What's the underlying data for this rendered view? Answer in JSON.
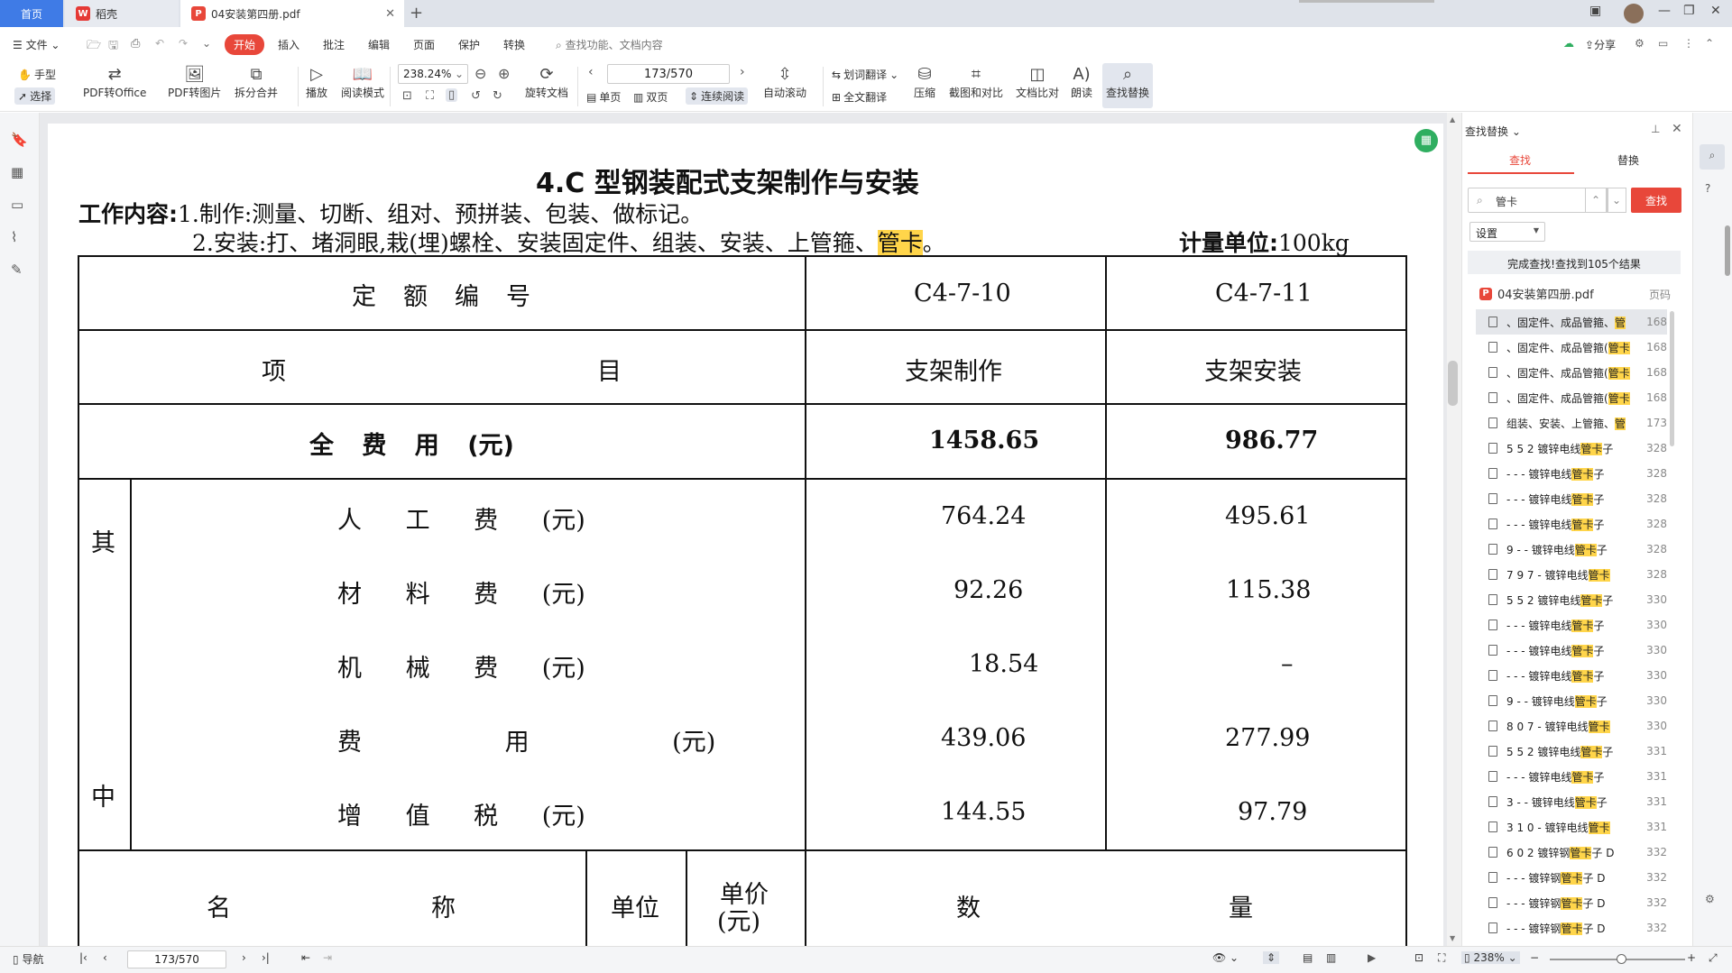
{
  "tabs": {
    "home": "首页",
    "daoke": "稻壳",
    "pdf": "04安装第四册.pdf"
  },
  "menu": {
    "file": "文件",
    "start": "开始",
    "insert": "插入",
    "annotate": "批注",
    "edit": "编辑",
    "page": "页面",
    "protect": "保护",
    "convert": "转换",
    "search_placeholder": "查找功能、文档内容",
    "share": "分享"
  },
  "ribbon": {
    "hand": "手型",
    "select": "选择",
    "pdf_to_office": "PDF转Office",
    "pdf_to_image": "PDF转图片",
    "split_merge": "拆分合并",
    "play": "播放",
    "read_mode": "阅读模式",
    "zoom": "238.24%",
    "page_input": "173/570",
    "rotate_doc": "旋转文档",
    "single_page": "单页",
    "double_page": "双页",
    "continuous": "连续阅读",
    "auto_scroll": "自动滚动",
    "word_translate": "划词翻译",
    "full_translate": "全文翻译",
    "compress": "压缩",
    "screenshot_compare": "截图和对比",
    "doc_compare": "文档比对",
    "read_aloud": "朗读",
    "find_replace": "查找替换"
  },
  "document": {
    "title": "4.C 型钢装配式支架制作与安装",
    "work_label": "工作内容:",
    "work_line1": "1.制作:测量、切断、组对、预拼装、包装、做标记。",
    "work_line2_pre": "2.安装:打、堵洞眼,栽(埋)螺栓、安装固定件、组装、安装、上管箍、",
    "work_line2_hl": "管卡",
    "work_line2_post": "。",
    "unit_label": "计量单位:",
    "unit_value": "100kg",
    "table": {
      "quota_no_label": "定额编号",
      "code1": "C4-7-10",
      "code2": "C4-7-11",
      "item_label_1": "项",
      "item_label_2": "目",
      "col1_name": "支架制作",
      "col2_name": "支架安装",
      "total_label": "全 费 用 (元)",
      "total1": "1458.65",
      "total2": "986.77",
      "qi": "其",
      "zhong": "中",
      "rows": [
        {
          "label": "人 工 费 (元)",
          "v1": "764.24",
          "v2": "495.61"
        },
        {
          "label": "材 料 费 (元)",
          "v1": "92.26",
          "v2": "115.38"
        },
        {
          "label": "机 械 费 (元)",
          "v1": "18.54",
          "v2": "–"
        },
        {
          "label": "费 用 (元)",
          "v1": "439.06",
          "v2": "277.99"
        },
        {
          "label": "增 值 税 (元)",
          "v1": "144.55",
          "v2": "97.79"
        }
      ],
      "name_label_1": "名",
      "name_label_2": "称",
      "unit_col": "单位",
      "price_col_1": "单价",
      "price_col_2": "(元)",
      "qty_label_1": "数",
      "qty_label_2": "量"
    }
  },
  "panel": {
    "title": "查找替换",
    "tab_find": "查找",
    "tab_replace": "替换",
    "search_value": "管卡",
    "find_button": "查找",
    "settings": "设置",
    "status": "完成查找!查找到105个结果",
    "file_name": "04安装第四册.pdf",
    "page_col": "页码",
    "results": [
      {
        "pre": "、固定件、成品管箍、",
        "hl": "管",
        "post": "",
        "page": "168"
      },
      {
        "pre": "、固定件、成品管箍(",
        "hl": "管卡",
        "post": "",
        "page": "168"
      },
      {
        "pre": "、固定件、成品管箍(",
        "hl": "管卡",
        "post": "",
        "page": "168"
      },
      {
        "pre": "、固定件、成品管箍(",
        "hl": "管卡",
        "post": "",
        "page": "168"
      },
      {
        "pre": "组装、安装、上管箍、",
        "hl": "管",
        "post": "",
        "page": "173"
      },
      {
        "pre": "5 5 2 镀锌电线",
        "hl": "管卡",
        "post": "子",
        "page": "328"
      },
      {
        "pre": "- - - 镀锌电线",
        "hl": "管卡",
        "post": "子",
        "page": "328"
      },
      {
        "pre": "- - - 镀锌电线",
        "hl": "管卡",
        "post": "子",
        "page": "328"
      },
      {
        "pre": "- - - 镀锌电线",
        "hl": "管卡",
        "post": "子",
        "page": "328"
      },
      {
        "pre": "9 - - 镀锌电线",
        "hl": "管卡",
        "post": "子",
        "page": "328"
      },
      {
        "pre": "7 9 7 - 镀锌电线",
        "hl": "管卡",
        "post": "",
        "page": "328"
      },
      {
        "pre": "5 5 2 镀锌电线",
        "hl": "管卡",
        "post": "子",
        "page": "330"
      },
      {
        "pre": "- - - 镀锌电线",
        "hl": "管卡",
        "post": "子",
        "page": "330"
      },
      {
        "pre": "- - - 镀锌电线",
        "hl": "管卡",
        "post": "子",
        "page": "330"
      },
      {
        "pre": "- - - 镀锌电线",
        "hl": "管卡",
        "post": "子",
        "page": "330"
      },
      {
        "pre": "9 - - 镀锌电线",
        "hl": "管卡",
        "post": "子",
        "page": "330"
      },
      {
        "pre": "8 0 7 - 镀锌电线",
        "hl": "管卡",
        "post": "",
        "page": "330"
      },
      {
        "pre": "5 5 2 镀锌电线",
        "hl": "管卡",
        "post": "子",
        "page": "331"
      },
      {
        "pre": "- - - 镀锌电线",
        "hl": "管卡",
        "post": "子",
        "page": "331"
      },
      {
        "pre": "3 - - 镀锌电线",
        "hl": "管卡",
        "post": "子",
        "page": "331"
      },
      {
        "pre": "3 1 0 - 镀锌电线",
        "hl": "管卡",
        "post": "",
        "page": "331"
      },
      {
        "pre": "6 0 2 镀锌钢",
        "hl": "管卡",
        "post": "子 D",
        "page": "332"
      },
      {
        "pre": "- - - 镀锌钢",
        "hl": "管卡",
        "post": "子 D",
        "page": "332"
      },
      {
        "pre": "- - - 镀锌钢",
        "hl": "管卡",
        "post": "子 D",
        "page": "332"
      },
      {
        "pre": "- - - 镀锌钢",
        "hl": "管卡",
        "post": "子 D",
        "page": "332"
      }
    ]
  },
  "statusbar": {
    "nav": "导航",
    "page_input": "173/570",
    "zoom": "238%"
  },
  "colors": {
    "accent": "#e8473a",
    "home_tab": "#3f7be6",
    "highlight": "#ffd54a"
  }
}
